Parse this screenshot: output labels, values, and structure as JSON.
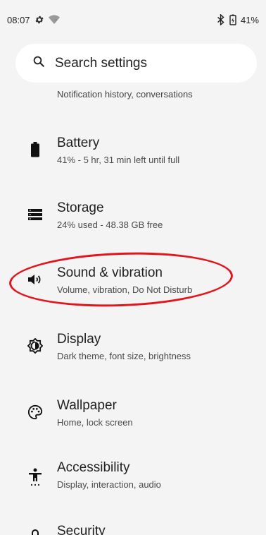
{
  "status": {
    "time": "08:07",
    "battery": "41%"
  },
  "search": {
    "placeholder": "Search settings"
  },
  "partial_item": {
    "subtitle": "Notification history, conversations"
  },
  "items": [
    {
      "title": "Battery",
      "subtitle": "41% - 5 hr, 31 min left until full",
      "icon": "battery-icon"
    },
    {
      "title": "Storage",
      "subtitle": "24% used - 48.38 GB free",
      "icon": "storage-icon"
    },
    {
      "title": "Sound & vibration",
      "subtitle": "Volume, vibration, Do Not Disturb",
      "icon": "volume-icon"
    },
    {
      "title": "Display",
      "subtitle": "Dark theme, font size, brightness",
      "icon": "brightness-icon"
    },
    {
      "title": "Wallpaper",
      "subtitle": "Home, lock screen",
      "icon": "palette-icon"
    },
    {
      "title": "Accessibility",
      "subtitle": "Display, interaction, audio",
      "icon": "accessibility-icon"
    },
    {
      "title": "Security",
      "icon": "lock-icon"
    }
  ],
  "colors": {
    "background": "#f4f4f4",
    "highlight": "#e3141b"
  }
}
